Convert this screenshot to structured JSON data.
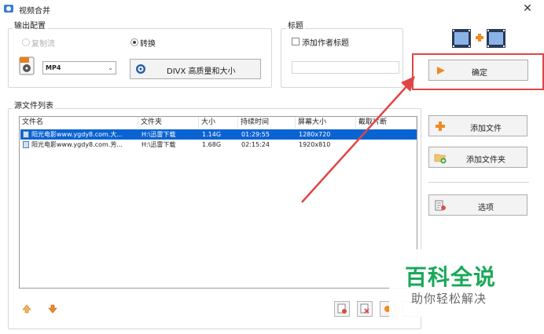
{
  "window": {
    "title": "视频合并",
    "close_glyph": "✕"
  },
  "output_config": {
    "legend": "输出配置",
    "radio_copy": "复制流",
    "radio_convert": "转换",
    "format_value": "MP4",
    "profile_label": "DIVX 高质量和大小"
  },
  "title_group": {
    "legend": "标题",
    "checkbox_label": "添加作者标题",
    "title_input_value": ""
  },
  "buttons": {
    "confirm": "确定",
    "add_file": "添加文件",
    "add_folder": "添加文件夹",
    "options": "选项"
  },
  "source_list": {
    "legend": "源文件列表",
    "columns": [
      "文件名",
      "文件夹",
      "大小",
      "持续时间",
      "屏幕大小",
      "截取片断"
    ],
    "rows": [
      {
        "name": "阳光电影www.ygdy8.com.大...",
        "folder": "H:\\迅雷下载",
        "size": "1.14G",
        "duration": "01:29:55",
        "screen": "1280x720",
        "selected": true
      },
      {
        "name": "阳光电影www.ygdy8.com.芳...",
        "folder": "H:\\迅雷下载",
        "size": "1.68G",
        "duration": "02:15:24",
        "screen": "1920x810",
        "selected": false
      }
    ]
  },
  "watermark": {
    "main": "百科全说",
    "sub": "助你轻松解决"
  },
  "colors": {
    "selection": "#0a63d3",
    "annotation_red": "#e04545",
    "watermark_green": "#1aa85a",
    "arrow_orange": "#f08a24"
  }
}
